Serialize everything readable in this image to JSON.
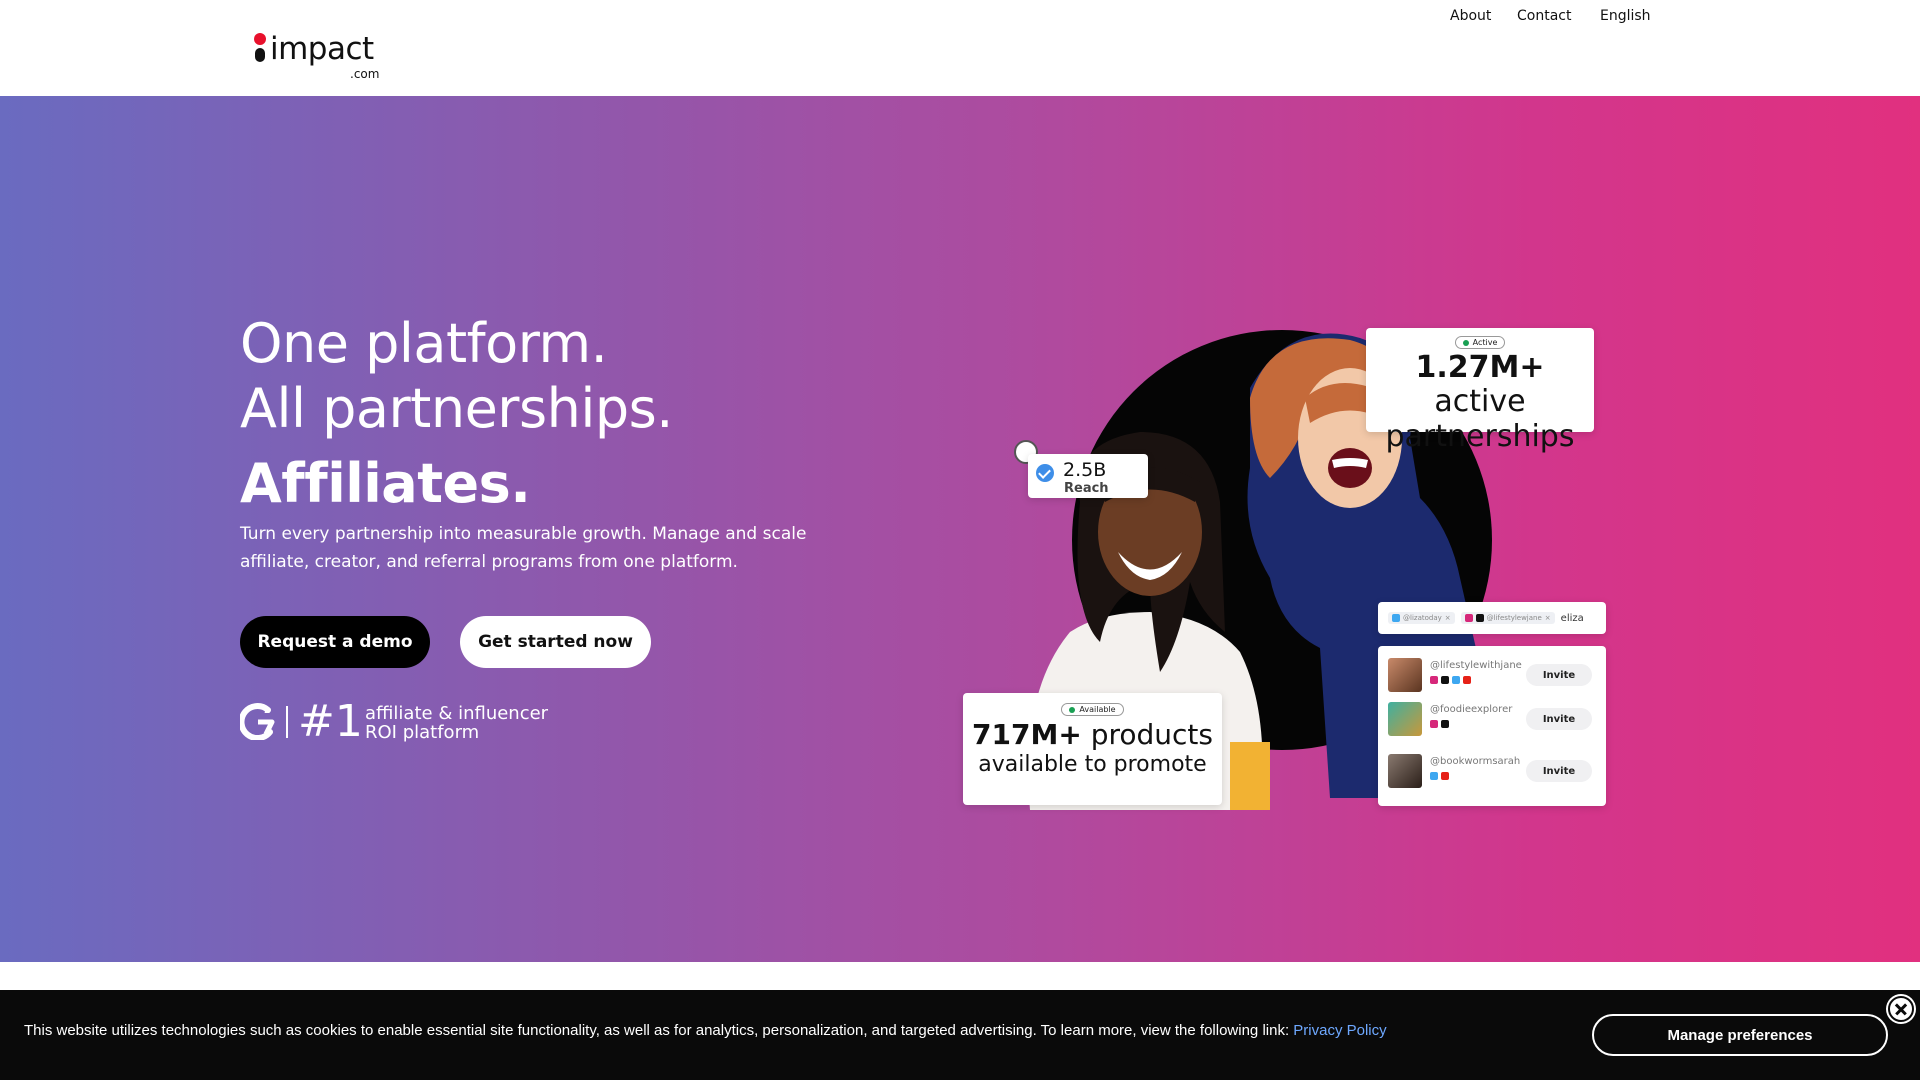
{
  "header": {
    "logo_word": "impact",
    "logo_com": ".com",
    "nav": {
      "about": "About",
      "contact": "Contact",
      "language": "English"
    }
  },
  "hero": {
    "headline_line1": "One platform.",
    "headline_line2": "All partnerships.",
    "rotating_word": "Affiliates.",
    "subtext": "Turn every partnership into measurable growth. Manage and scale affiliate, creator, and referral programs from one platform.",
    "primary_button": "Request a demo",
    "secondary_button": "Get started now",
    "g2": {
      "rank": "#1",
      "line1": "affiliate & influencer",
      "line2": "ROI platform"
    }
  },
  "illustration": {
    "active_card": {
      "status": "Active",
      "value": "1.27M+",
      "label1": "active",
      "label2": "partnerships"
    },
    "reach_card": {
      "value": "2.5B",
      "label": "Reach"
    },
    "products_card": {
      "status": "Available",
      "value": "717M+",
      "label1": "products",
      "label2": "available to promote"
    },
    "search": {
      "chips": [
        "@lizatoday",
        "@lifestylewjane"
      ],
      "typed": "eliza"
    },
    "creators": [
      {
        "handle": "@lifestylewithjane",
        "action": "Invite"
      },
      {
        "handle": "@foodieexplorer",
        "action": "Invite"
      },
      {
        "handle": "@bookwormsarah",
        "action": "Invite"
      }
    ]
  },
  "cookie": {
    "text": "This website utilizes technologies such as cookies to enable essential site functionality, as well as for analytics, personalization, and targeted advertising. To learn more, view the following link: ",
    "link": "Privacy Policy",
    "manage_button": "Manage preferences"
  },
  "colors": {
    "gradient_start": "#6a6bc0",
    "gradient_end": "#e1307f",
    "logo_red": "#e8102c",
    "link_blue": "#6ea8ff"
  }
}
